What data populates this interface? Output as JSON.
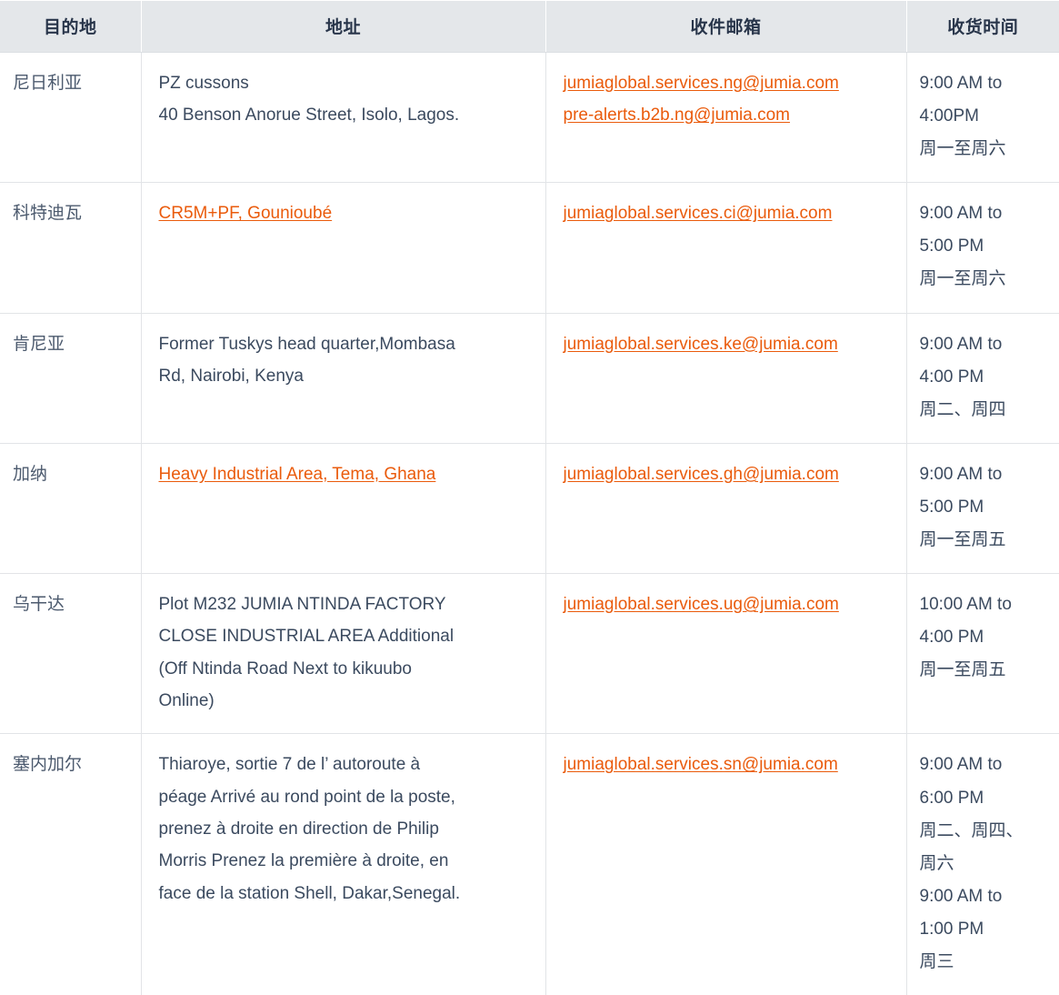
{
  "table": {
    "headers": [
      {
        "key": "destination",
        "label": "目的地"
      },
      {
        "key": "address",
        "label": "地址"
      },
      {
        "key": "email",
        "label": "收件邮箱"
      },
      {
        "key": "time",
        "label": "收货时间"
      }
    ],
    "colors": {
      "header_bg": "#e4e7ea",
      "header_text": "#28354a",
      "body_text": "#3b4a5f",
      "link": "#ea5b0c",
      "border": "#e2e4e7"
    },
    "rows": [
      {
        "destination": "尼日利亚",
        "address_is_link": false,
        "address_lines": [
          "PZ cussons",
          "40 Benson Anorue Street, Isolo, Lagos."
        ],
        "emails": [
          "jumiaglobal.services.ng@jumia.com",
          "pre-alerts.b2b.ng@jumia.com"
        ],
        "time_lines": [
          "9:00 AM to",
          "4:00PM",
          "周一至周六"
        ]
      },
      {
        "destination": "科特迪瓦",
        "address_is_link": true,
        "address_lines": [
          "CR5M+PF, Gounioubé"
        ],
        "emails": [
          "jumiaglobal.services.ci@jumia.com"
        ],
        "time_lines": [
          "9:00 AM to",
          "5:00 PM",
          "周一至周六"
        ]
      },
      {
        "destination": "肯尼亚",
        "address_is_link": false,
        "address_lines": [
          "Former Tuskys head quarter,Mombasa",
          "Rd, Nairobi, Kenya"
        ],
        "emails": [
          "jumiaglobal.services.ke@jumia.com"
        ],
        "time_lines": [
          "9:00 AM to",
          "4:00 PM",
          "周二、周四"
        ]
      },
      {
        "destination": "加纳",
        "address_is_link": true,
        "address_lines": [
          "Heavy Industrial Area, Tema, Ghana"
        ],
        "emails": [
          "jumiaglobal.services.gh@jumia.com"
        ],
        "time_lines": [
          "9:00 AM to",
          "5:00 PM",
          "周一至周五"
        ]
      },
      {
        "destination": "乌干达",
        "address_is_link": false,
        "address_lines": [
          "Plot M232 JUMIA NTINDA FACTORY",
          "CLOSE INDUSTRIAL AREA Additional",
          "(Off Ntinda Road Next to kikuubo",
          "Online)"
        ],
        "emails": [
          "jumiaglobal.services.ug@jumia.com"
        ],
        "time_lines": [
          "10:00 AM to",
          "4:00 PM",
          "周一至周五"
        ]
      },
      {
        "destination": "塞内加尔",
        "address_is_link": false,
        "address_lines": [
          "Thiaroye, sortie 7 de l’ autoroute à",
          "péage Arrivé au rond point de la poste,",
          "prenez à droite en direction de Philip",
          "Morris Prenez la première à droite, en",
          "face de la station Shell, Dakar,Senegal."
        ],
        "emails": [
          "jumiaglobal.services.sn@jumia.com"
        ],
        "time_lines": [
          "9:00 AM to",
          "6:00 PM",
          "周二、周四、",
          "周六",
          "9:00 AM to",
          "1:00 PM",
          "周三"
        ]
      }
    ]
  }
}
